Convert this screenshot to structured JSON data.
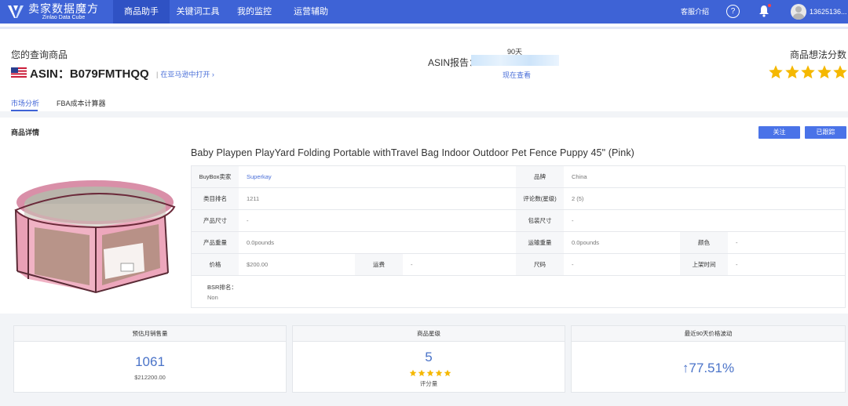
{
  "colors": {
    "brand": "#3e63d6",
    "accent": "#4a73e8",
    "link": "#4a6fd8",
    "star": "#f5b800"
  },
  "brand": {
    "name": "卖家数据魔方",
    "subtitle": "Zinlao Data Cube",
    "logo_icon": "brand-logo-icon"
  },
  "nav": {
    "items": [
      "商品助手",
      "关键词工具",
      "我的监控",
      "运营辅助"
    ],
    "help_label": "客服介绍",
    "user_phone": "13625136..."
  },
  "header": {
    "title": "您的查询商品",
    "asin": "ASIN：B079FMTHQQ",
    "open_link": "在亚马逊中打开",
    "report_days": "90天",
    "report_label": "ASIN报告：",
    "report_link": "现在查看",
    "score_label": "商品想法分数",
    "score_value": 5,
    "score_max": 5
  },
  "tabs": [
    "市场分析",
    "FBA成本计算器"
  ],
  "detail": {
    "section_title": "商品详情",
    "follow_button": "关注",
    "followed_button": "已跟踪",
    "product_title": "Baby Playpen PlayYard Folding Portable withTravel Bag Indoor Outdoor Pet Fence Puppy 45\" (Pink)",
    "specs": {
      "buybox_seller_label": "BuyBox卖家",
      "buybox_seller": "Superkay",
      "brand_label": "品牌",
      "brand": "China",
      "category_rank_label": "类目排名",
      "category_rank": "1211",
      "reviews_label": "评论数(星级)",
      "reviews": "2 (5)",
      "product_size_label": "产品尺寸",
      "product_size": "-",
      "package_size_label": "包装尺寸",
      "package_size": "-",
      "product_weight_label": "产品重量",
      "product_weight": "0.0pounds",
      "shipping_weight_label": "运输重量",
      "shipping_weight": "0.0pounds",
      "color_label": "颜色",
      "color": "-",
      "price_label": "价格",
      "price": "$200.00",
      "shipping_label": "运费",
      "shipping": "-",
      "size_label": "尺码",
      "size": "-",
      "listed_label": "上架时间",
      "listed": "-",
      "bsr_label": "BSR排名：",
      "bsr": "Non"
    }
  },
  "stats": [
    {
      "title": "预估月销售量",
      "value": "1061",
      "sub": "$212200.00"
    },
    {
      "title": "商品星级",
      "value": "5",
      "sub": "评分量",
      "stars": 5
    },
    {
      "title": "最近90天价格波动",
      "value": "↑77.51%"
    }
  ]
}
